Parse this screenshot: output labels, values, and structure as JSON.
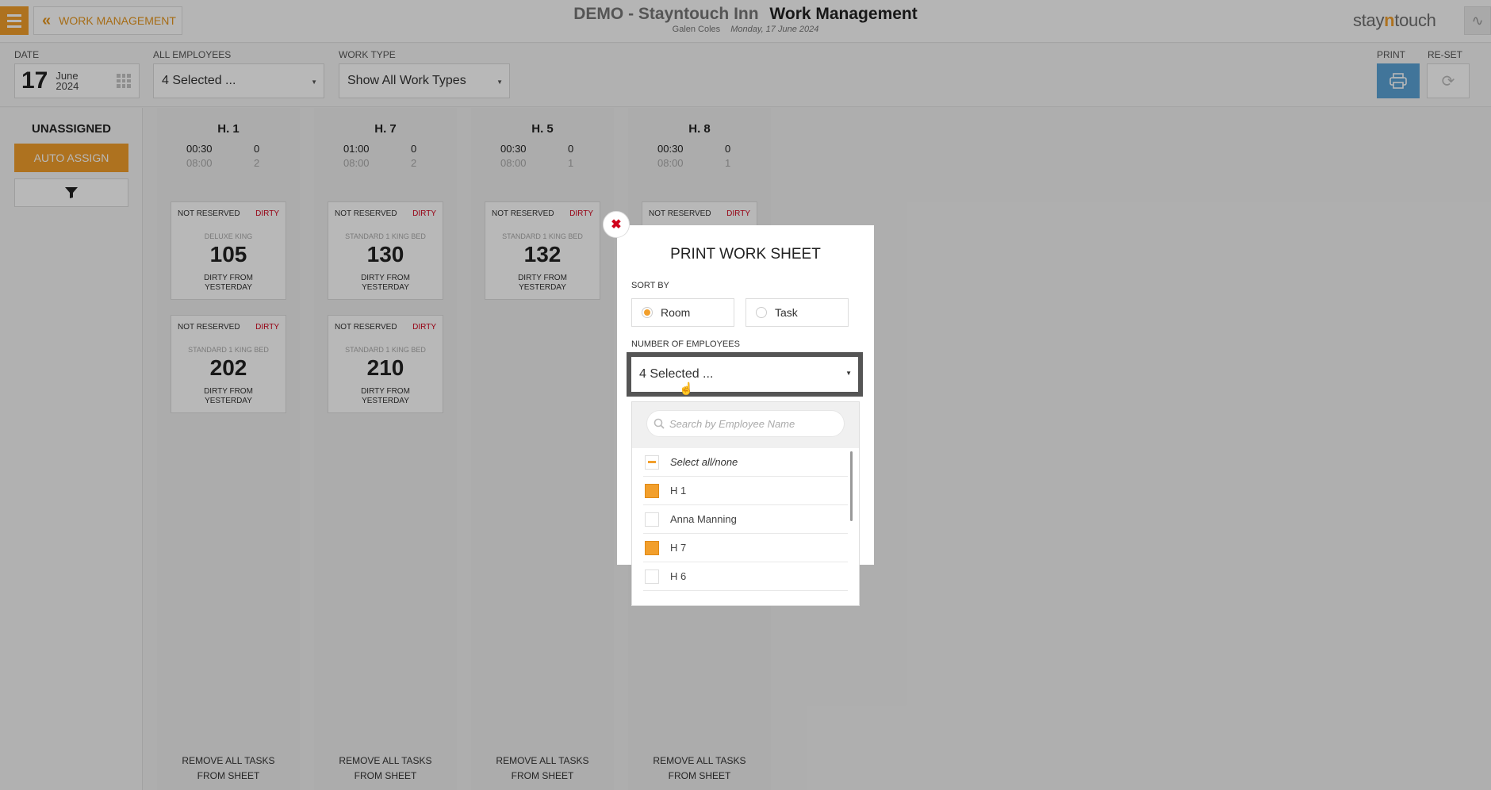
{
  "topbar": {
    "back_label": "WORK MANAGEMENT",
    "title_demo": "DEMO - Stayntouch Inn",
    "title_main": "Work Management",
    "user": "Galen Coles",
    "date": "Monday, 17 June 2024",
    "logo_pre": "stay",
    "logo_mid": "n",
    "logo_post": "touch"
  },
  "filters": {
    "date_label": "DATE",
    "date_day": "17",
    "date_month": "June",
    "date_year": "2024",
    "employees_label": "ALL EMPLOYEES",
    "employees_value": "4 Selected ...",
    "worktype_label": "WORK TYPE",
    "worktype_value": "Show All Work Types",
    "print_label": "PRINT",
    "reset_label": "RE-SET"
  },
  "sidebar": {
    "heading": "UNASSIGNED",
    "auto_assign": "AUTO ASSIGN"
  },
  "columns": [
    {
      "name": "H. 1",
      "time": "00:30",
      "time2": "08:00",
      "count": "0",
      "count2": "2",
      "cards": [
        {
          "status_l": "NOT RESERVED",
          "status_r": "DIRTY",
          "type": "DELUXE KING",
          "room": "105",
          "note1": "DIRTY FROM",
          "note2": "YESTERDAY"
        },
        {
          "status_l": "NOT RESERVED",
          "status_r": "DIRTY",
          "type": "STANDARD 1 KING BED",
          "room": "202",
          "note1": "DIRTY FROM",
          "note2": "YESTERDAY"
        }
      ]
    },
    {
      "name": "H. 7",
      "time": "01:00",
      "time2": "08:00",
      "count": "0",
      "count2": "2",
      "cards": [
        {
          "status_l": "NOT RESERVED",
          "status_r": "DIRTY",
          "type": "STANDARD 1 KING BED",
          "room": "130",
          "note1": "DIRTY FROM",
          "note2": "YESTERDAY"
        },
        {
          "status_l": "NOT RESERVED",
          "status_r": "DIRTY",
          "type": "STANDARD 1 KING BED",
          "room": "210",
          "note1": "DIRTY FROM",
          "note2": "YESTERDAY"
        }
      ]
    },
    {
      "name": "H. 5",
      "time": "00:30",
      "time2": "08:00",
      "count": "0",
      "count2": "1",
      "cards": [
        {
          "status_l": "NOT RESERVED",
          "status_r": "DIRTY",
          "type": "STANDARD 1 KING BED",
          "room": "132",
          "note1": "DIRTY FROM",
          "note2": "YESTERDAY"
        }
      ]
    },
    {
      "name": "H. 8",
      "time": "00:30",
      "time2": "08:00",
      "count": "0",
      "count2": "1",
      "cards": [
        {
          "status_l": "NOT RESERVED",
          "status_r": "DIRTY",
          "type": "",
          "room": "",
          "note1": "",
          "note2": ""
        }
      ]
    }
  ],
  "remove_label_1": "REMOVE ALL TASKS",
  "remove_label_2": "FROM SHEET",
  "modal": {
    "title": "PRINT WORK SHEET",
    "sort_label": "SORT BY",
    "sort_room": "Room",
    "sort_task": "Task",
    "employees_label": "NUMBER OF EMPLOYEES",
    "employees_value": "4 Selected ...",
    "search_placeholder": "Search by Employee Name",
    "select_all": "Select all/none",
    "employees": [
      {
        "name": "H 1",
        "checked": true
      },
      {
        "name": "Anna Manning",
        "checked": false
      },
      {
        "name": "H 7",
        "checked": true
      },
      {
        "name": "H 6",
        "checked": false
      }
    ]
  },
  "colors": {
    "accent": "#f29f2c",
    "dirty": "#d0021b",
    "print": "#5ba3d6"
  }
}
